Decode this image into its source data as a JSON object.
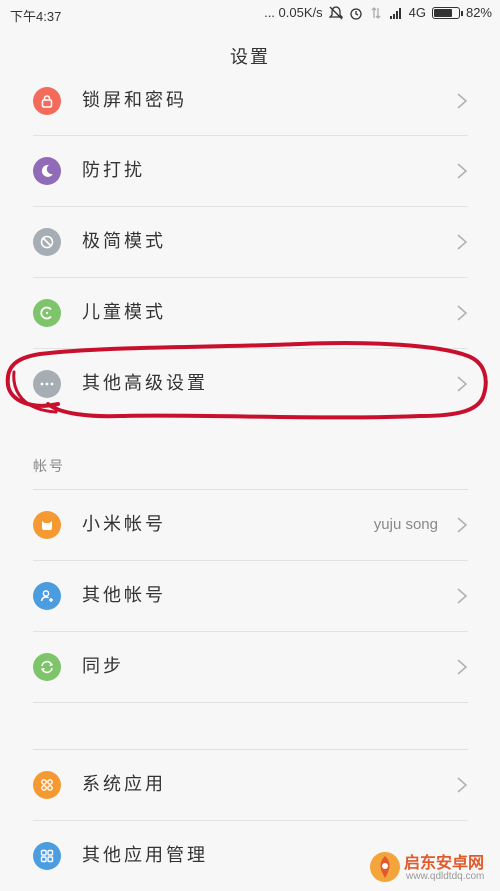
{
  "status_bar": {
    "time": "下午4:37",
    "network_speed": "... 0.05K/s",
    "network_type": "4G",
    "battery": "82%",
    "battery_level": 0.82
  },
  "title": "设置",
  "rows_group1": [
    {
      "label": "锁屏和密码",
      "icon": "lock-icon",
      "color": "#f36c5b"
    },
    {
      "label": "防打扰",
      "icon": "moon-icon",
      "color": "#8f6bb8"
    },
    {
      "label": "极简模式",
      "icon": "compass-icon",
      "color": "#a7adb5"
    },
    {
      "label": "儿童模式",
      "icon": "kids-icon",
      "color": "#7dc46a"
    },
    {
      "label": "其他高级设置",
      "icon": "more-icon",
      "color": "#a7adb5"
    }
  ],
  "section_account": "帐号",
  "rows_group2": [
    {
      "label": "小米帐号",
      "value": "yuju song",
      "icon": "mi-account-icon",
      "color": "#f59a32"
    },
    {
      "label": "其他帐号",
      "icon": "user-add-icon",
      "color": "#4c9ce0"
    },
    {
      "label": "同步",
      "icon": "sync-icon",
      "color": "#7dc46a"
    }
  ],
  "rows_group3": [
    {
      "label": "系统应用",
      "icon": "apps-icon",
      "color": "#f59a32"
    },
    {
      "label": "其他应用管理",
      "icon": "grid-icon",
      "color": "#4c9ce0"
    }
  ],
  "watermark": {
    "name": "启东安卓网",
    "url": "www.qdldtdq.com"
  },
  "colors": {
    "annotation": "#c8102e",
    "text": "#333333",
    "secondary": "#888888"
  }
}
